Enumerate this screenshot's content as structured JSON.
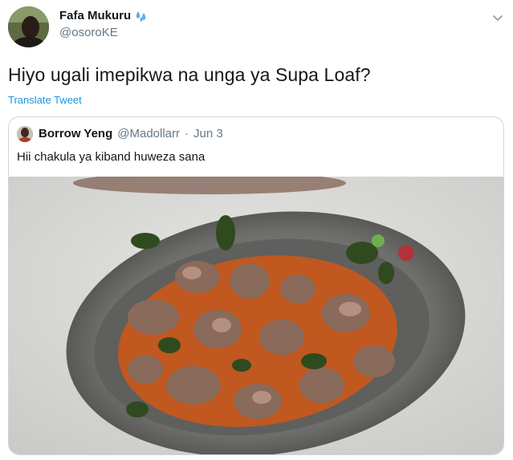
{
  "tweet": {
    "display_name": "Fafa Mukuru",
    "emoji_icon": "sweat-droplets-icon",
    "handle": "@osoroKE",
    "text": "Hiyo ugali imepikwa na unga ya Supa Loaf?",
    "translate_label": "Translate Tweet"
  },
  "quote": {
    "display_name": "Borrow Yeng",
    "handle": "@Madollarr",
    "separator": "·",
    "date": "Jun 3",
    "text": "Hii chakula ya kiband huweza sana"
  },
  "colors": {
    "link": "#1b95e0",
    "secondary_text": "#657786",
    "border": "#ccd6dd"
  }
}
